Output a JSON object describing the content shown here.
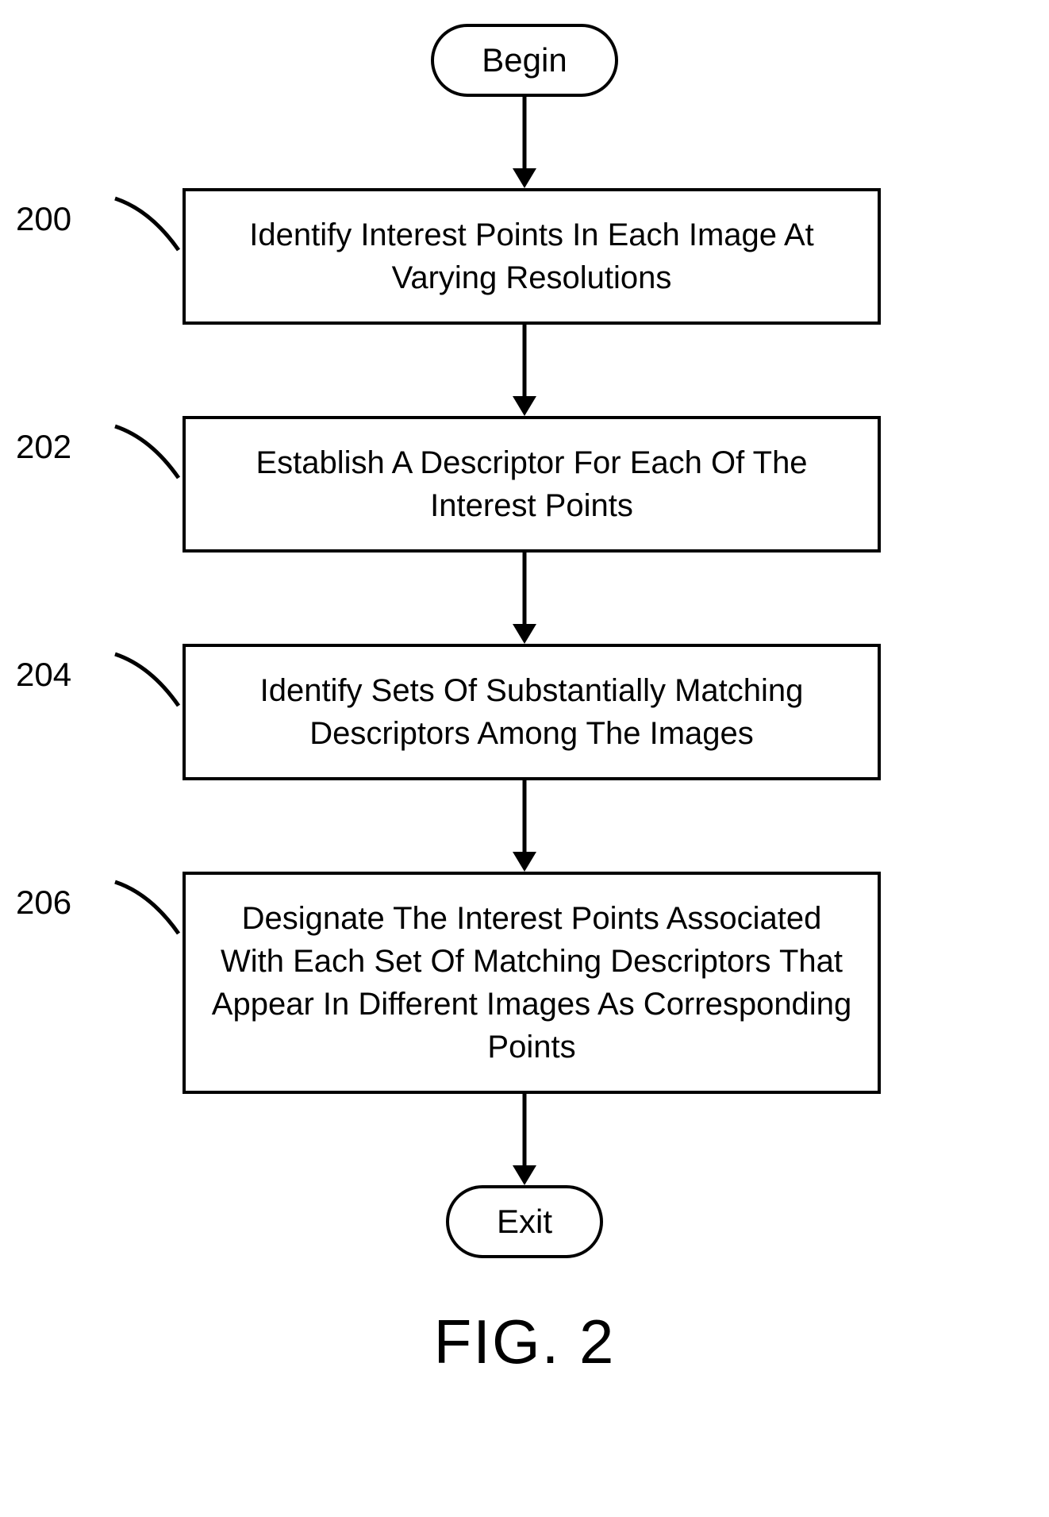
{
  "terminal_begin": "Begin",
  "terminal_exit": "Exit",
  "steps": [
    {
      "num": "200",
      "text": "Identify Interest Points In Each Image At Varying Resolutions"
    },
    {
      "num": "202",
      "text": "Establish A Descriptor For Each Of The Interest Points"
    },
    {
      "num": "204",
      "text": "Identify Sets Of Substantially Matching Descriptors Among The Images"
    },
    {
      "num": "206",
      "text": "Designate The Interest Points Associated With Each Set Of Matching Descriptors That Appear In Different Images As Corresponding Points"
    }
  ],
  "figure_label": "FIG. 2"
}
